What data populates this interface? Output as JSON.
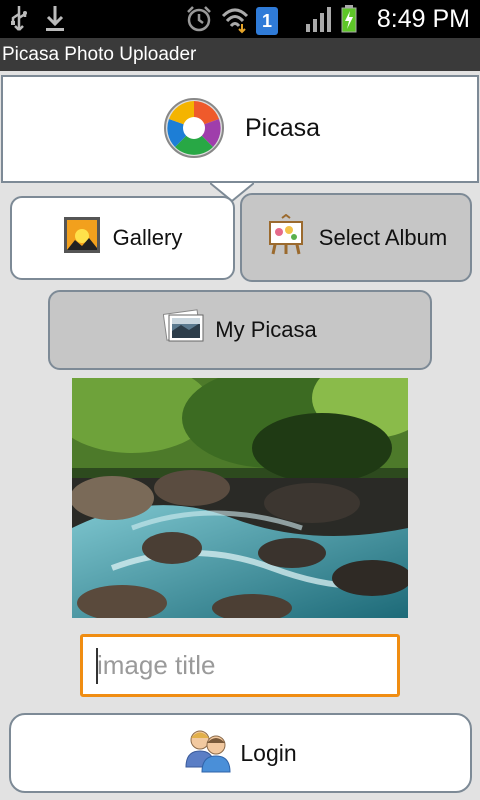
{
  "status_bar": {
    "time": "8:49 PM",
    "icons": [
      "usb-icon",
      "download-icon",
      "alarm-icon",
      "wifi-icon",
      "sim-1-icon",
      "signal-icon",
      "battery-charging-icon"
    ],
    "sim_number": "1"
  },
  "app": {
    "title": "Picasa Photo Uploader"
  },
  "header": {
    "label": "Picasa",
    "icon": "picasa-logo-icon"
  },
  "buttons": {
    "gallery": {
      "label": "Gallery",
      "icon": "gallery-icon"
    },
    "select_album": {
      "label": "Select Album",
      "icon": "album-easel-icon"
    },
    "my_picasa": {
      "label": "My Picasa",
      "icon": "photos-icon"
    },
    "login": {
      "label": "Login",
      "icon": "users-icon"
    }
  },
  "image_title_input": {
    "value": "",
    "placeholder": "image title"
  },
  "colors": {
    "background": "#e2e2e2",
    "title_bar": "#3a3a3a",
    "input_focus": "#f08d12",
    "button_grey": "#c6c6c6",
    "border": "#7d8a96"
  }
}
